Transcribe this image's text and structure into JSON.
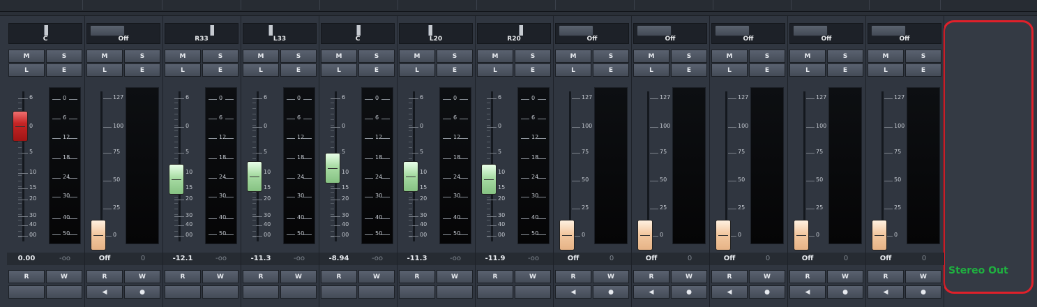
{
  "output": {
    "label": "Stereo Out"
  },
  "strips": [
    {
      "type": "audio",
      "pan": "C",
      "pan_pos": 0.5,
      "buttons": [
        "M",
        "S",
        "L",
        "E"
      ],
      "fader": "red",
      "volume": "0.00",
      "peak": "-oo",
      "bottom": [
        "R",
        "W",
        "",
        ""
      ]
    },
    {
      "type": "midi",
      "pan": "Off",
      "buttons": [
        "M",
        "S",
        "L",
        "E"
      ],
      "fader": "peach",
      "volume": "Off",
      "peak": "0",
      "bottom": [
        "R",
        "W",
        "◀",
        "●"
      ]
    },
    {
      "type": "audio",
      "pan": "R33",
      "pan_pos": 0.64,
      "buttons": [
        "M",
        "S",
        "L",
        "E"
      ],
      "fader": "green",
      "volume": "-12.1",
      "peak": "-oo",
      "bottom": [
        "R",
        "W",
        "",
        ""
      ]
    },
    {
      "type": "audio",
      "pan": "L33",
      "pan_pos": 0.36,
      "buttons": [
        "M",
        "S",
        "L",
        "E"
      ],
      "fader": "green",
      "volume": "-11.3",
      "peak": "-oo",
      "bottom": [
        "R",
        "W",
        "",
        ""
      ]
    },
    {
      "type": "audio",
      "pan": "C",
      "pan_pos": 0.5,
      "buttons": [
        "M",
        "S",
        "L",
        "E"
      ],
      "fader": "green",
      "volume": "-8.94",
      "peak": "-oo",
      "bottom": [
        "R",
        "W",
        "",
        ""
      ]
    },
    {
      "type": "audio",
      "pan": "L20",
      "pan_pos": 0.41,
      "buttons": [
        "M",
        "S",
        "L",
        "E"
      ],
      "fader": "green",
      "volume": "-11.3",
      "peak": "-oo",
      "bottom": [
        "R",
        "W",
        "",
        ""
      ]
    },
    {
      "type": "audio",
      "pan": "R20",
      "pan_pos": 0.59,
      "buttons": [
        "M",
        "S",
        "L",
        "E"
      ],
      "fader": "green",
      "volume": "-11.9",
      "peak": "-oo",
      "bottom": [
        "R",
        "W",
        "",
        ""
      ]
    },
    {
      "type": "midi",
      "pan": "Off",
      "buttons": [
        "M",
        "S",
        "L",
        "E"
      ],
      "fader": "peach",
      "volume": "Off",
      "peak": "0",
      "bottom": [
        "R",
        "W",
        "◀",
        "●"
      ]
    },
    {
      "type": "midi",
      "pan": "Off",
      "buttons": [
        "M",
        "S",
        "L",
        "E"
      ],
      "fader": "peach",
      "volume": "Off",
      "peak": "0",
      "bottom": [
        "R",
        "W",
        "◀",
        "●"
      ]
    },
    {
      "type": "midi",
      "pan": "Off",
      "buttons": [
        "M",
        "S",
        "L",
        "E"
      ],
      "fader": "peach",
      "volume": "Off",
      "peak": "0",
      "bottom": [
        "R",
        "W",
        "◀",
        "●"
      ]
    },
    {
      "type": "midi",
      "pan": "Off",
      "buttons": [
        "M",
        "S",
        "L",
        "E"
      ],
      "fader": "peach",
      "volume": "Off",
      "peak": "0",
      "bottom": [
        "R",
        "W",
        "◀",
        "●"
      ]
    },
    {
      "type": "midi",
      "pan": "Off",
      "buttons": [
        "M",
        "S",
        "L",
        "E"
      ],
      "fader": "peach",
      "volume": "Off",
      "peak": "0",
      "bottom": [
        "R",
        "W",
        "◀",
        "●"
      ]
    }
  ],
  "scales": {
    "audio_fader": [
      "6",
      "0",
      "5",
      "10",
      "15",
      "20",
      "30",
      "40",
      "00"
    ],
    "audio_meter": [
      "0",
      "6",
      "12",
      "18",
      "24",
      "30",
      "40",
      "50"
    ],
    "midi_fader": [
      "127",
      "100",
      "75",
      "50",
      "25",
      "0"
    ]
  }
}
